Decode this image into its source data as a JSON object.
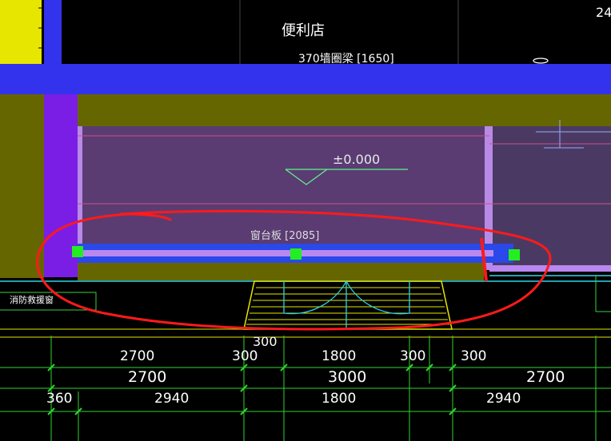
{
  "drawing": {
    "room_label": "便利店",
    "beam_label": "370墙圈梁 [1650]",
    "elevation_label": "±0.000",
    "sill_label": "窗台板 [2085]",
    "window_label": "消防救援窗",
    "corner_number": "24"
  },
  "dimensions": {
    "row1": [
      "2700",
      "300",
      "1800",
      "300",
      "300"
    ],
    "row1_top": "300",
    "row2": [
      "2700",
      "3000",
      "2700"
    ],
    "row3": [
      "360",
      "2940",
      "1800",
      "2940"
    ]
  },
  "colors": {
    "beam_blue": "#3333ee",
    "wall_olive": "#666600",
    "room_purple": "#5a3c73",
    "column_violet": "#7a1ee6",
    "grip_green": "#22ee22",
    "markup_red": "#ff1a1a",
    "yellow": "#e6e600"
  }
}
